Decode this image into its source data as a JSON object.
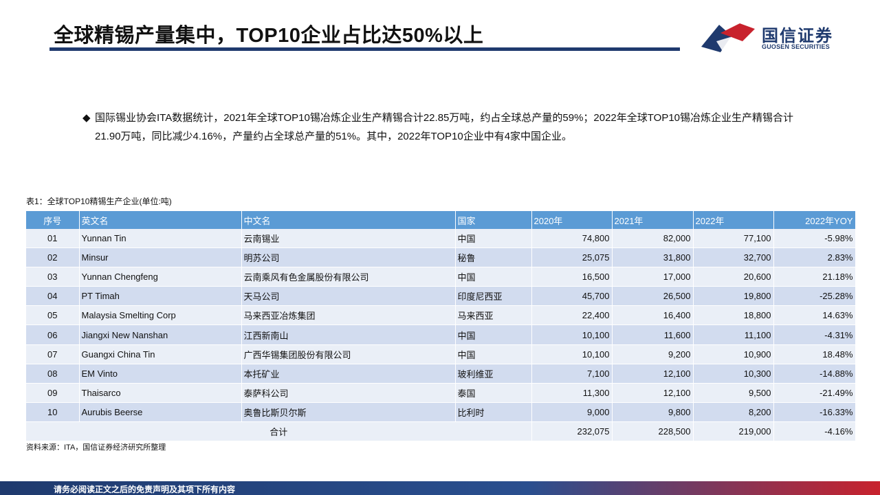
{
  "header": {
    "title": "全球精锡产量集中，TOP10企业占比达50%以上",
    "logo_cn": "国信证券",
    "logo_en": "GUOSEN SECURITIES"
  },
  "bullet": {
    "mark": "◆",
    "text": "国际锡业协会ITA数据统计，2021年全球TOP10锡冶炼企业生产精锡合计22.85万吨，约占全球总产量的59%；2022年全球TOP10锡冶炼企业生产精锡合计21.90万吨，同比减少4.16%，产量约占全球总产量的51%。其中，2022年TOP10企业中有4家中国企业。"
  },
  "table": {
    "caption": "表1：全球TOP10精锡生产企业(单位:吨)",
    "headers": [
      "序号",
      "英文名",
      "中文名",
      "国家",
      "2020年",
      "2021年",
      "2022年",
      "2022年YOY"
    ],
    "rows": [
      [
        "01",
        "Yunnan Tin",
        "云南锡业",
        "中国",
        "74,800",
        "82,000",
        "77,100",
        "-5.98%"
      ],
      [
        "02",
        "Minsur",
        "明苏公司",
        "秘鲁",
        "25,075",
        "31,800",
        "32,700",
        "2.83%"
      ],
      [
        "03",
        "Yunnan Chengfeng",
        "云南乘风有色金属股份有限公司",
        "中国",
        "16,500",
        "17,000",
        "20,600",
        "21.18%"
      ],
      [
        "04",
        "PT Timah",
        "天马公司",
        "印度尼西亚",
        "45,700",
        "26,500",
        "19,800",
        "-25.28%"
      ],
      [
        "05",
        "Malaysia Smelting Corp",
        "马来西亚冶炼集团",
        "马来西亚",
        "22,400",
        "16,400",
        "18,800",
        "14.63%"
      ],
      [
        "06",
        "Jiangxi New Nanshan",
        "江西新南山",
        "中国",
        "10,100",
        "11,600",
        "11,100",
        "-4.31%"
      ],
      [
        "07",
        "Guangxi China Tin",
        "广西华锡集团股份有限公司",
        "中国",
        "10,100",
        "9,200",
        "10,900",
        "18.48%"
      ],
      [
        "08",
        "EM Vinto",
        "本托矿业",
        "玻利维亚",
        "7,100",
        "12,100",
        "10,300",
        "-14.88%"
      ],
      [
        "09",
        "Thaisarco",
        "泰萨科公司",
        "泰国",
        "11,300",
        "12,100",
        "9,500",
        "-21.49%"
      ],
      [
        "10",
        "Aurubis Beerse",
        "奥鲁比斯贝尔斯",
        "比利时",
        "9,000",
        "9,800",
        "8,200",
        "-16.33%"
      ]
    ],
    "total": {
      "label": "合计",
      "y2020": "232,075",
      "y2021": "228,500",
      "y2022": "219,000",
      "yoy": "-4.16%"
    }
  },
  "source": "资料来源：ITA，国信证券经济研究所整理",
  "footer": {
    "disclaimer": "请务必阅读正文之后的免责声明及其项下所有内容"
  },
  "colors": {
    "navy": "#1f3a6e",
    "header_blue": "#5b9bd5",
    "row_light": "#eaeff7",
    "row_dark": "#d2dcef",
    "brand_red": "#c8222d"
  }
}
